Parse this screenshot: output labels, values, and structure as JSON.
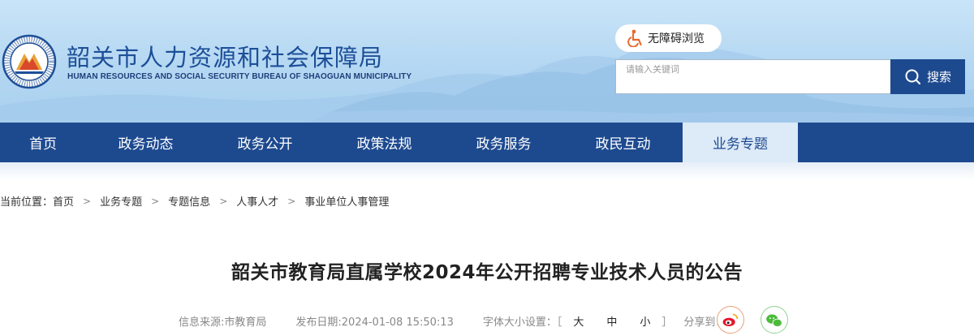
{
  "header": {
    "title": "韶关市人力资源和社会保障局",
    "subtitle": "HUMAN RESOURCES AND SOCIAL SECURITY BUREAU OF SHAOGUAN MUNICIPALITY",
    "accessibility_label": "无障碍浏览",
    "search_placeholder": "请输入关键词",
    "search_button": "搜索"
  },
  "nav": {
    "items": [
      {
        "label": "首页"
      },
      {
        "label": "政务动态"
      },
      {
        "label": "政务公开"
      },
      {
        "label": "政策法规"
      },
      {
        "label": "政务服务"
      },
      {
        "label": "政民互动"
      },
      {
        "label": "业务专题"
      }
    ],
    "active_index": 6
  },
  "breadcrumb": {
    "prefix": "当前位置：",
    "items": [
      "首页",
      "业务专题",
      "专题信息",
      "人事人才",
      "事业单位人事管理"
    ],
    "separator": ">"
  },
  "article": {
    "title": "韶关市教育局直属学校2024年公开招聘专业技术人员的公告",
    "source": "信息来源:市教育局",
    "published": "发布日期:2024-01-08 15:50:13",
    "font_size_label": "字体大小设置：［",
    "font_sizes": [
      "大",
      "中",
      "小"
    ],
    "font_size_close": "］",
    "share_label": "分享到："
  },
  "colors": {
    "nav_background": "#1d4a8f",
    "nav_active_background": "#ddeaf8",
    "title_blue": "#1d4f98"
  },
  "icons": {
    "accessibility": "wheelchair-icon",
    "search": "search-icon",
    "share_weibo": "weibo-icon",
    "share_wechat": "wechat-icon"
  }
}
